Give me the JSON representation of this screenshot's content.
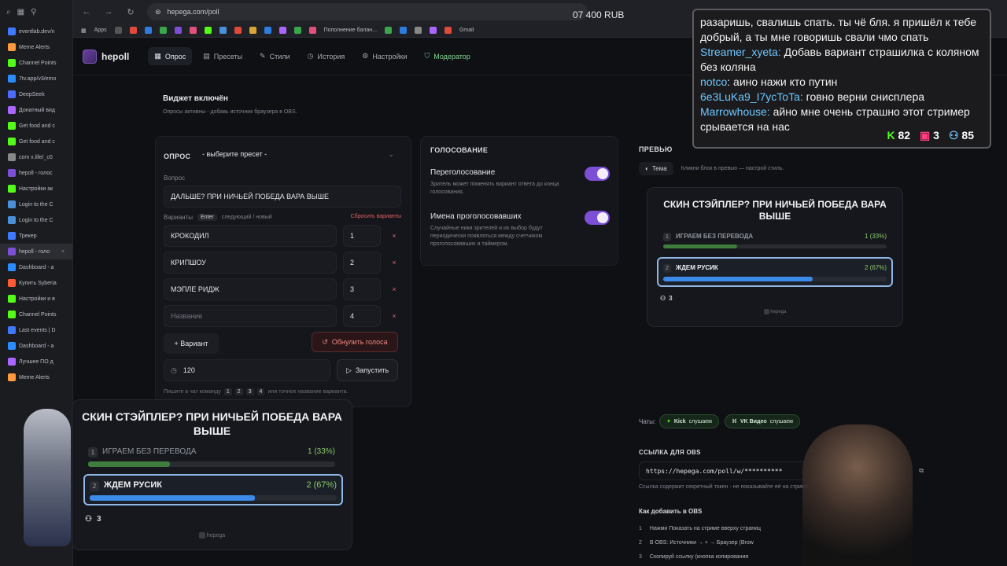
{
  "browser": {
    "url": "hepega.com/poll",
    "balance": "07 400 RUB",
    "apps_label": "Apps",
    "bookmarks": [
      "Пополнение балан...",
      "Gmail"
    ],
    "tabs": [
      {
        "label": "eventlab.dev/n",
        "color": "#3f79ff"
      },
      {
        "label": "Meme Alerts",
        "color": "#ff9a3c"
      },
      {
        "label": "Channel Points",
        "color": "#53fc18"
      },
      {
        "label": "7tv.app/v3/emo",
        "color": "#2b8cff"
      },
      {
        "label": "DeepSeek",
        "color": "#4d6bfe"
      },
      {
        "label": "Донатный вид",
        "color": "#aa66ff"
      },
      {
        "label": "Get food and c",
        "color": "#53fc18"
      },
      {
        "label": "Get food and c",
        "color": "#53fc18"
      },
      {
        "label": "com x.life/_c0",
        "color": "#888888"
      },
      {
        "label": "hepoll - голос",
        "color": "#7b4fd6"
      },
      {
        "label": "Настройки ак",
        "color": "#53fc18"
      },
      {
        "label": "Login to the C",
        "color": "#4a90d9"
      },
      {
        "label": "Login to the C",
        "color": "#4a90d9"
      },
      {
        "label": "Трекер",
        "color": "#3f79ff"
      },
      {
        "label": "hepoll - голо",
        "color": "#7b4fd6",
        "active": true
      },
      {
        "label": "Dashboard - a",
        "color": "#2b8cff"
      },
      {
        "label": "Купить Syberia",
        "color": "#ff5a36"
      },
      {
        "label": "Настройки и в",
        "color": "#53fc18"
      },
      {
        "label": "Channel Points",
        "color": "#53fc18"
      },
      {
        "label": "Last events | D",
        "color": "#3f79ff"
      },
      {
        "label": "Dashboard - a",
        "color": "#2b8cff"
      },
      {
        "label": "Лучшее ПО д",
        "color": "#aa66ff"
      },
      {
        "label": "Meme Alerts",
        "color": "#ff9a3c"
      }
    ]
  },
  "app": {
    "brand": "hepoll",
    "nav": [
      "Опрос",
      "Пресеты",
      "Стили",
      "История",
      "Настройки"
    ],
    "nav_moderator": "Модератор",
    "widget_status": "Виджет включён",
    "widget_hint": "Опросы активны - добавь источник браузера в OBS.",
    "left": {
      "poll_label": "ОПРОС",
      "preset_placeholder": "- выберите пресет -",
      "question_label": "Вопрос",
      "question": "ДАЛЬШЕ? ПРИ НИЧЬЕЙ ПОБЕДА ВАРА ВЫШЕ",
      "variants_label": "Варианты",
      "enter_key": "Enter",
      "enter_hint": "следующий / новый",
      "reset_variants": "Сбросить варианты",
      "options": [
        {
          "text": "КРОКОДИЛ",
          "num": "1"
        },
        {
          "text": "КРИПШОУ",
          "num": "2"
        },
        {
          "text": "МЭПЛЕ РИДЖ",
          "num": "3"
        }
      ],
      "new_option_placeholder": "Название",
      "new_option_num": "4",
      "add_variant": "+ Вариант",
      "reset_votes": "Обнулить голоса",
      "timer": "120",
      "start": "Запустить",
      "chat_hint_pre": "Пишите в чат команду",
      "chat_hint_nums": [
        "1",
        "2",
        "3",
        "4"
      ],
      "chat_hint_post": "или точное название варианта."
    },
    "voting": {
      "heading": "ГОЛОСОВАНИЕ",
      "revote_title": "Переголосование",
      "revote_desc": "Зритель может поменять вариант ответа до конца голосования.",
      "revote_on": true,
      "names_title": "Имена проголосовавших",
      "names_desc": "Случайные ники зрителей и их выбор будут периодически появляться между счетчиком проголосовавших и таймером.",
      "names_on": true
    },
    "preview": {
      "heading": "ПРЕВЬЮ",
      "theme": "Тема",
      "theme_hint": "Кликни блок в превью — настрой стиль.",
      "chats_label": "Чаты:",
      "chat_kick": "Kick",
      "chat_kick_status": "слушаем",
      "chat_vk": "VK Видео",
      "chat_vk_status": "слушаем",
      "obs_link_heading": "ССЫЛКА ДЛЯ OBS",
      "obs_link": "https://hepega.com/poll/w/**********",
      "obs_link_hint": "Ссылка содержит секретный токен - не показывайте её на стриме.",
      "obs_howto_heading": "Как добавить в OBS",
      "obs_steps": [
        {
          "num": "1",
          "text": "Нажми Показать на стриме вверху страниц"
        },
        {
          "num": "2",
          "text": "В OBS: Источники → + → Браузер (Brow"
        },
        {
          "num": "3",
          "text": "Скопируй ссылку (кнопка копирования"
        }
      ]
    },
    "poll_widget": {
      "title": "СКИН СТЭЙПЛЕР? ПРИ НИЧЬЕЙ ПОБЕДА ВАРА ВЫШЕ",
      "options": [
        {
          "num": "1",
          "label": "ИГРАЕМ БЕЗ ПЕРЕВОДА",
          "result": "1 (33%)",
          "share": 0.33,
          "color": "#3e7d3e"
        },
        {
          "num": "2",
          "label": "ЖДЕМ РУСИК",
          "result": "2 (67%)",
          "share": 0.67,
          "color": "#3d8be8",
          "leading": true
        }
      ],
      "voters": "3",
      "footer": "hepega"
    }
  },
  "chat_overlay": {
    "messages": [
      {
        "user": "",
        "text": "разаришь, свалишь спать. ты чё бля. я пришёл к тебе добрый, а ты мне говоришь свали чмо спать"
      },
      {
        "user": "Streamer_xyeta:",
        "text": " Добавь вариант страшилка с коляном без коляна"
      },
      {
        "user": "notco",
        "text": ": аино нажи кто путин"
      },
      {
        "user": "6e3LuKa9_I7ycToTa:",
        "text": " говно верни снисплера"
      },
      {
        "user": "Marrowhouse:",
        "text": " айно мне очень страшно этот стример срывается на нас"
      }
    ],
    "kick_viewers": "82",
    "vk_viewers": "3",
    "total_viewers": "85"
  }
}
